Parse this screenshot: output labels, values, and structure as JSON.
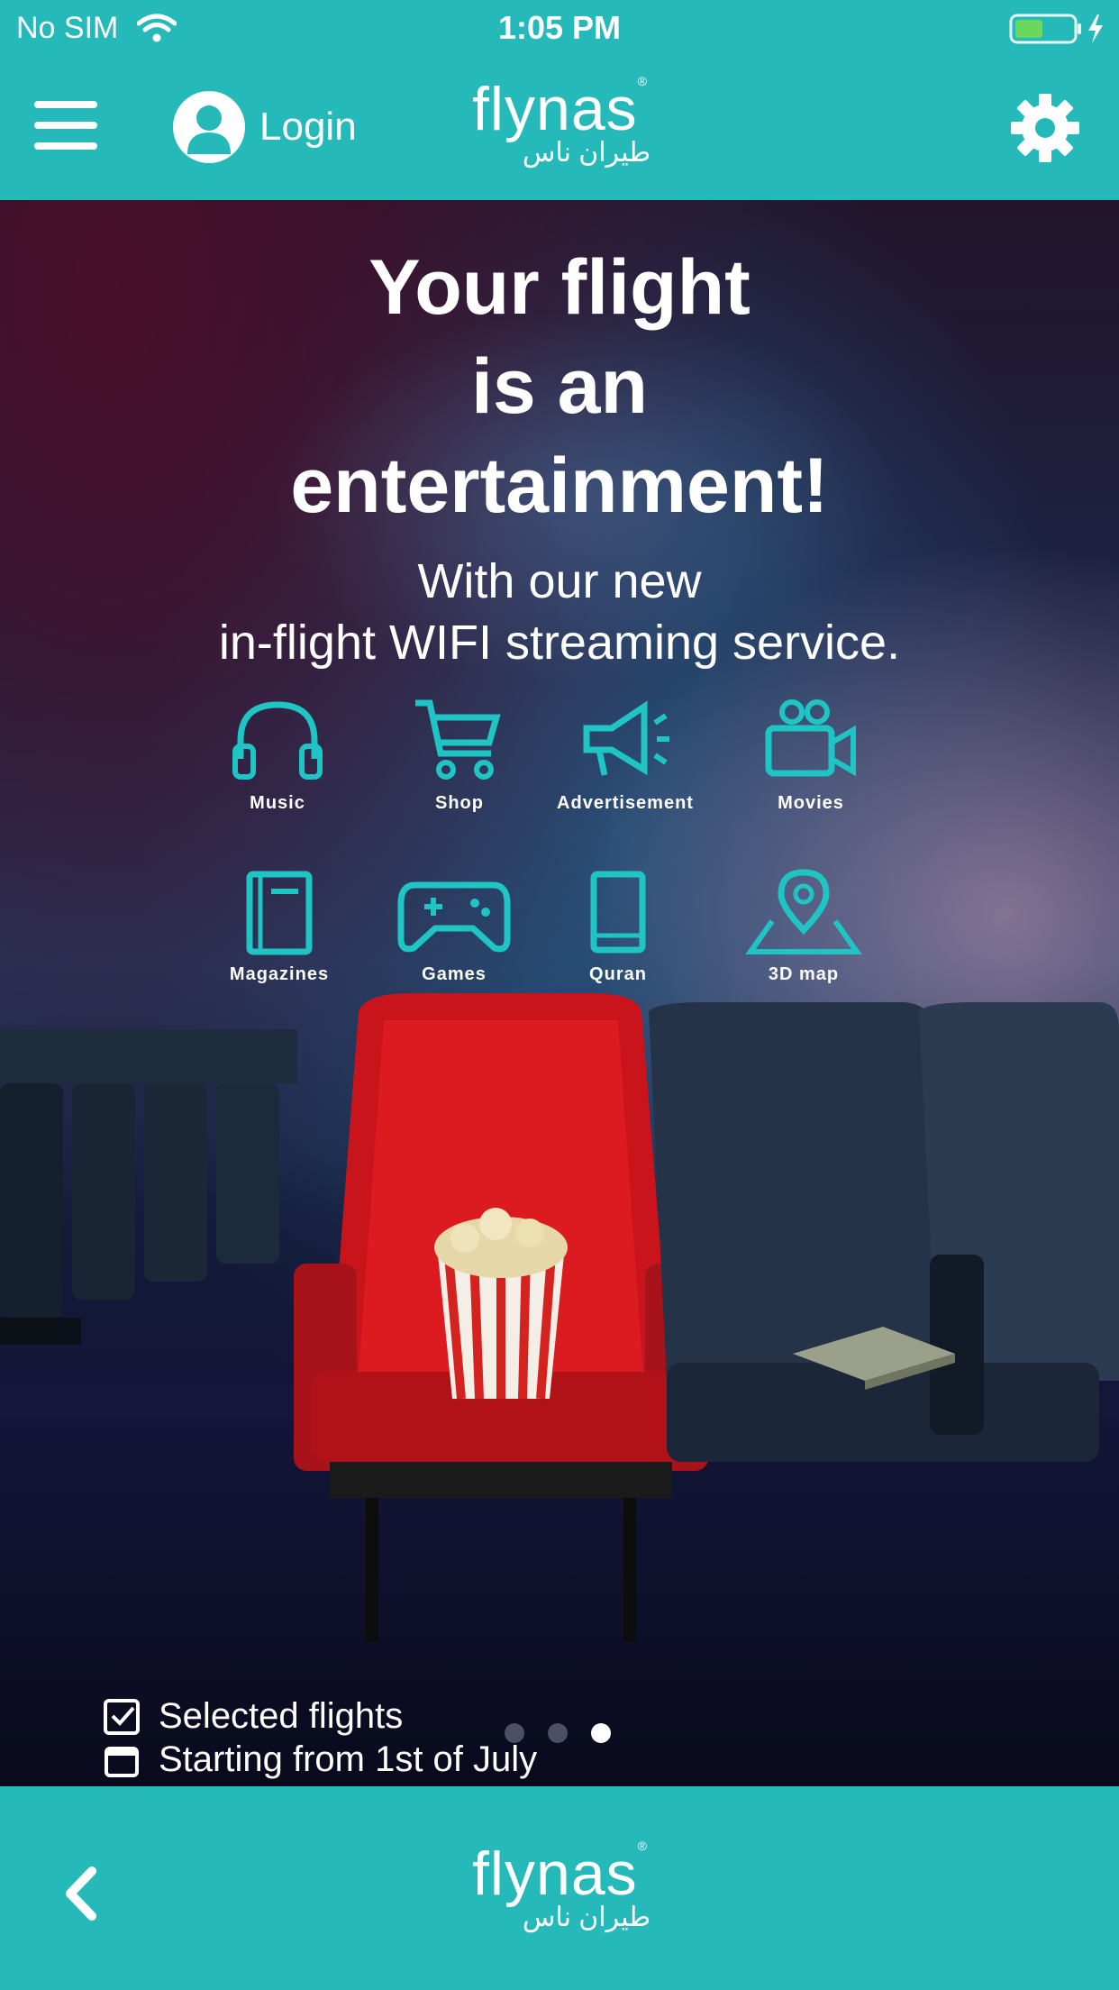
{
  "status_bar": {
    "carrier": "No SIM",
    "time": "1:05 PM",
    "wifi_icon": "wifi-icon",
    "battery_icon": "battery-charging-icon"
  },
  "header": {
    "menu_icon": "hamburger-menu-icon",
    "login_label": "Login",
    "avatar_icon": "user-avatar-icon",
    "brand_name": "flynas",
    "brand_arabic": "طيران ناس",
    "settings_icon": "gear-icon"
  },
  "banner": {
    "headline_line1": "Your flight",
    "headline_line2": "is an",
    "headline_line3": "entertainment!",
    "subline1": "With our new",
    "subline2": "in-flight WIFI streaming service.",
    "features": [
      {
        "label": "Music",
        "icon": "headphones-icon"
      },
      {
        "label": "Shop",
        "icon": "shopping-cart-icon"
      },
      {
        "label": "Advertisement",
        "icon": "megaphone-icon"
      },
      {
        "label": "Movies",
        "icon": "video-camera-icon"
      },
      {
        "label": "Magazines",
        "icon": "magazine-icon"
      },
      {
        "label": "Games",
        "icon": "gamepad-icon"
      },
      {
        "label": "Quran",
        "icon": "book-icon"
      },
      {
        "label": "3D map",
        "icon": "map-pin-icon"
      }
    ],
    "caption_selected": "Selected flights",
    "caption_date": "Starting from 1st of July",
    "carousel_total": 3,
    "carousel_active": 3
  },
  "footer": {
    "back_icon": "chevron-left-icon",
    "brand_name": "flynas",
    "brand_arabic": "طيران ناس"
  },
  "colors": {
    "teal": "#26b9b9",
    "feature_icon": "#1fc4c4",
    "seat_red": "#d0141b"
  }
}
